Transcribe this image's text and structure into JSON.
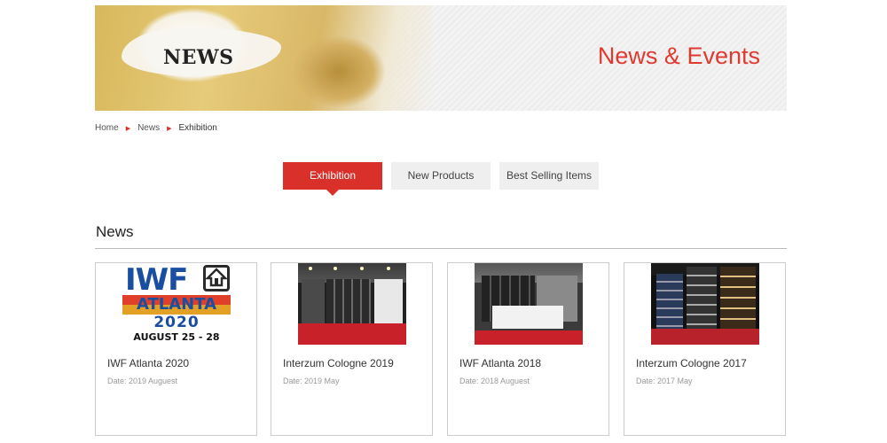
{
  "banner": {
    "image_word": "NEWS",
    "title": "News & Events"
  },
  "breadcrumb": {
    "items": [
      "Home",
      "News",
      "Exhibition"
    ]
  },
  "tabs": [
    {
      "label": "Exhibition",
      "active": true
    },
    {
      "label": "New Products",
      "active": false
    },
    {
      "label": "Best Selling Items",
      "active": false
    }
  ],
  "section": {
    "title": "News"
  },
  "logo_art": {
    "iwf": "IWF",
    "atlanta": "ATLANTA",
    "year": "2020",
    "dates": "AUGUST 25 - 28"
  },
  "cards": [
    {
      "title": "IWF Atlanta 2020",
      "date": "Date: 2019 Auguest"
    },
    {
      "title": "Interzum Cologne 2019",
      "date": "Date: 2019 May"
    },
    {
      "title": "IWF Atlanta 2018",
      "date": "Date: 2018 Auguest"
    },
    {
      "title": "Interzum Cologne 2017",
      "date": "Date: 2017 May"
    }
  ],
  "colors": {
    "accent": "#d9302a",
    "title_red": "#e03a30",
    "tab_inactive": "#efefef"
  }
}
